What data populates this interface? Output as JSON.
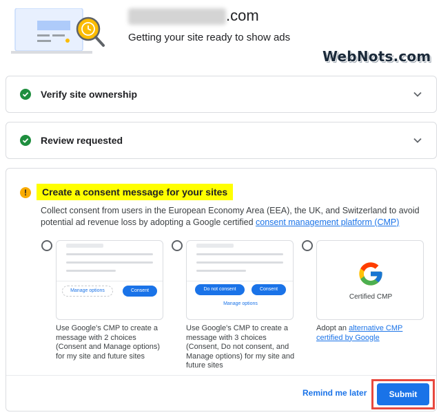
{
  "header": {
    "domain_tld": ".com",
    "subtitle": "Getting your site ready to show ads",
    "watermark": "WebNots.com"
  },
  "steps": [
    {
      "label": "Verify site ownership",
      "status": "complete"
    },
    {
      "label": "Review requested",
      "status": "complete"
    }
  ],
  "consent": {
    "title": "Create a consent message for your sites",
    "description": "Collect consent from users in the European Economy Area (EEA), the UK, and Switzerland to avoid potential ad revenue loss by adopting a Google certified ",
    "description_link": "consent management platform (CMP)",
    "options": [
      {
        "preview_buttons": [
          "Manage options",
          "Consent"
        ],
        "text": "Use Google's CMP to create a message with 2 choices (Consent and Manage options) for my site and future sites"
      },
      {
        "preview_buttons": [
          "Do not consent",
          "Consent"
        ],
        "preview_link": "Manage options",
        "text": "Use Google's CMP to create a message with 3 choices (Consent, Do not consent, and Manage options) for my site and future sites"
      },
      {
        "preview_label": "Certified CMP",
        "text_prefix": "Adopt an ",
        "text_link": "alternative CMP certified by Google"
      }
    ],
    "remind_label": "Remind me later",
    "submit_label": "Submit"
  },
  "colors": {
    "accent": "#1a73e8",
    "success": "#1e8e3e",
    "warning": "#f9ab00",
    "highlight": "#ffff00",
    "frame": "#e8483e"
  },
  "icons": [
    "site-preview-illustration",
    "clock-magnifier-icon",
    "check-icon",
    "chevron-down-icon",
    "warning-icon",
    "google-g-logo"
  ]
}
